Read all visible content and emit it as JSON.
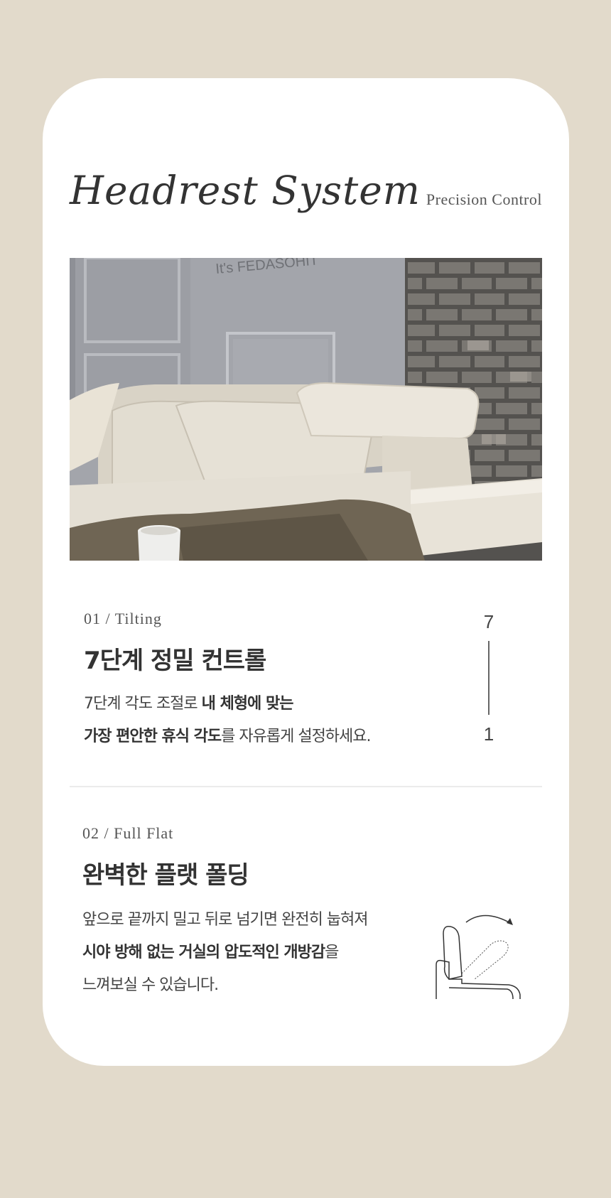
{
  "header": {
    "title": "Headrest System",
    "subtitle": "Precision Control"
  },
  "photo": {
    "wall_text": "It's FEDASOHIT",
    "description_icon": "sofa-photo"
  },
  "section1": {
    "label": "01 / Tilting",
    "heading": "7단계 정밀 컨트롤",
    "line1_plain": "7단계 각도 조절로 ",
    "line1_bold": "내 체형에 맞는",
    "line2_bold": "가장 편안한 휴식 각도",
    "line2_plain": "를 자유롭게 설정하세요.",
    "scale_top": "7",
    "scale_bottom": "1"
  },
  "section2": {
    "label": "02 / Full Flat",
    "heading": "완벽한 플랫 폴딩",
    "line1": "앞으로 끝까지 밀고 뒤로 넘기면 완전히 눕혀져",
    "line2_bold": "시야 방해 없는 거실의 압도적인 개방감",
    "line2_plain": "을",
    "line3": "느껴보실 수 있습니다.",
    "icon": "headrest-fold-icon"
  },
  "colors": {
    "background": "#e2dacb",
    "card": "#ffffff",
    "text": "#333333"
  }
}
